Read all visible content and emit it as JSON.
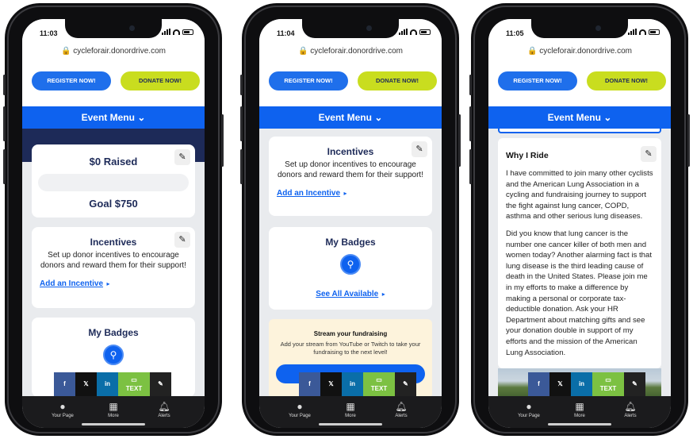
{
  "phones": [
    {
      "status_time": "11:03",
      "url": "cycleforair.donordrive.com",
      "register_label": "REGISTER NOW!",
      "donate_label": "DONATE NOW!",
      "event_menu": "Event Menu",
      "raised": "$0 Raised",
      "goal": "Goal $750",
      "raised_fraction": 0,
      "incentives_title": "Incentives",
      "incentives_text": "Set up donor incentives to encourage donors and reward them for their support!",
      "add_incentive": "Add an Incentive",
      "badges_title": "My Badges"
    },
    {
      "status_time": "11:04",
      "url": "cycleforair.donordrive.com",
      "register_label": "REGISTER NOW!",
      "donate_label": "DONATE NOW!",
      "event_menu": "Event Menu",
      "incentives_title": "Incentives",
      "incentives_text": "Set up donor incentives to encourage donors and reward them for their support!",
      "add_incentive": "Add an Incentive",
      "badges_title": "My Badges",
      "see_all": "See All Available",
      "stream_title": "Stream your fundraising",
      "stream_text": "Add your stream from YouTube or Twitch to take your fundraising to the next level!"
    },
    {
      "status_time": "11:05",
      "url": "cycleforair.donordrive.com",
      "register_label": "REGISTER NOW!",
      "donate_label": "DONATE NOW!",
      "event_menu": "Event Menu",
      "why_title": "Why I Ride",
      "why_p1": "I have committed to join many other cyclists and the American Lung Association in a cycling and fundraising journey to support the fight against lung cancer, COPD, asthma and other serious lung diseases.",
      "why_p2": "Did you know that lung cancer is the number one cancer killer of both men and women today? Another alarming fact is that lung disease is the third leading cause of death in the United States. Please join me in my efforts to make a difference by making a personal or corporate tax-deductible donation. Ask your HR Department about matching gifts and see your donation double in support of my efforts and the mission of the American Lung Association."
    }
  ],
  "share": {
    "facebook": "f",
    "x": "𝕏",
    "linkedin": "in",
    "text": "TEXT",
    "link_icon": "link-icon"
  },
  "tabs": {
    "your_page": "Your Page",
    "more": "More",
    "alerts": "Alerts"
  },
  "colors": {
    "brand_blue": "#0e62ef",
    "donate_green": "#c9dd1f",
    "navy": "#1d2a58"
  }
}
